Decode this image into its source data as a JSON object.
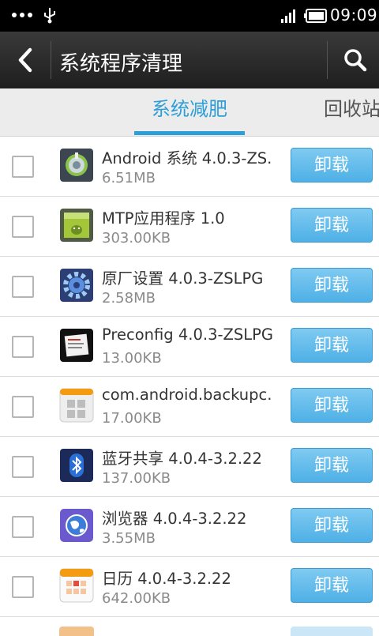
{
  "status_bar": {
    "time": "09:09",
    "icons": [
      "more-dots-icon",
      "usb-icon",
      "signal-icon",
      "battery-icon"
    ]
  },
  "title_bar": {
    "title": "系统程序清理",
    "back_icon": "chevron-left-icon",
    "search_icon": "search-icon"
  },
  "tabs": [
    {
      "label": "系统减肥",
      "active": true
    },
    {
      "label": "回收站",
      "active": false
    }
  ],
  "colors": {
    "accent": "#2d9ed8",
    "button": "#5ab6e9",
    "titlebar": "#2a2a2a"
  },
  "apps": [
    {
      "name": "Android 系统 4.0.3-ZS.",
      "size": "6.51MB",
      "icon": "android-system-icon",
      "action": "卸载"
    },
    {
      "name": "MTP应用程序 1.0",
      "size": "303.00KB",
      "icon": "android-package-icon",
      "action": "卸载"
    },
    {
      "name": "原厂设置 4.0.3-ZSLPG",
      "size": "2.58MB",
      "icon": "gear-settings-icon",
      "action": "卸载"
    },
    {
      "name": "Preconfig 4.0.3-ZSLPG",
      "size": "13.00KB",
      "icon": "preconfig-icon",
      "action": "卸载"
    },
    {
      "name": "com.android.backupc.",
      "size": "17.00KB",
      "icon": "backup-grid-icon",
      "action": "卸载"
    },
    {
      "name": "蓝牙共享 4.0.4-3.2.22",
      "size": "137.00KB",
      "icon": "bluetooth-icon",
      "action": "卸载"
    },
    {
      "name": "浏览器 4.0.4-3.2.22",
      "size": "3.55MB",
      "icon": "browser-globe-icon",
      "action": "卸载"
    },
    {
      "name": "日历 4.0.4-3.2.22",
      "size": "642.00KB",
      "icon": "calendar-icon",
      "action": "卸载"
    }
  ]
}
